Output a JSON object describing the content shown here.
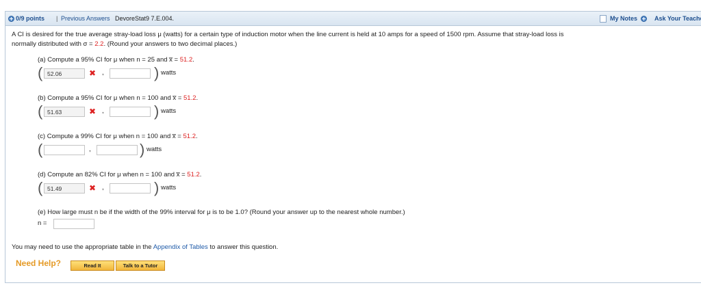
{
  "header": {
    "points": "0/9 points",
    "separator": "|",
    "previous_answers": "Previous Answers",
    "question_id": "DevoreStat9 7.E.004.",
    "my_notes": "My Notes",
    "ask_teacher": "Ask Your Teacher"
  },
  "problem": {
    "line1_a": "A CI is desired for the true average stray-load loss μ (watts) for a certain type of induction motor when the line current is held at 10 amps for a speed of 1500 rpm. Assume that stray-load loss is",
    "line2_a": "normally distributed with σ = ",
    "sigma": "2.2",
    "line2_b": ". (Round your answers to two decimal places.)"
  },
  "parts": [
    {
      "label": "(a) Compute a 95% CI for μ when n = 25 and x̅ = ",
      "xbar": "51.2",
      "end": ".",
      "lower": "52.06",
      "upper": "",
      "unit": "watts",
      "wrong": true
    },
    {
      "label": "(b) Compute a 95% CI for μ when n = 100 and x̅ = ",
      "xbar": "51.2",
      "end": ".",
      "lower": "51.63",
      "upper": "",
      "unit": "watts",
      "wrong": true
    },
    {
      "label": "(c) Compute a 99% CI for μ when n = 100 and x̅ = ",
      "xbar": "51.2",
      "end": ".",
      "lower": "",
      "upper": "",
      "unit": "watts",
      "wrong": false
    },
    {
      "label": "(d) Compute an 82% CI for μ when n = 100 and x̅ = ",
      "xbar": "51.2",
      "end": ".",
      "lower": "51.49",
      "upper": "",
      "unit": "watts",
      "wrong": true
    }
  ],
  "part_e": {
    "label": "(e) How large must n be if the width of the 99% interval for μ is to be 1.0? (Round your answer up to the nearest whole number.)",
    "n_label": "n =",
    "n_value": ""
  },
  "footer": {
    "note_a": "You may need to use the appropriate table in the ",
    "link": "Appendix of Tables",
    "note_b": " to answer this question.",
    "need_help": "Need Help?",
    "read_it": "Read It",
    "talk_tutor": "Talk to a Tutor"
  },
  "comma": ",",
  "wrong_mark": "✖"
}
